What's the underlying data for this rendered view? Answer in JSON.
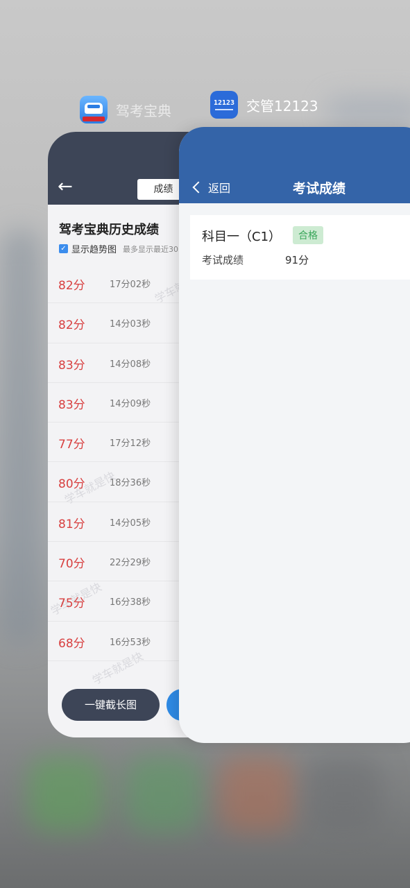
{
  "apps": {
    "jiakao": {
      "name": "驾考宝典",
      "icon": "jiakao-app-icon",
      "header": {
        "tab_label": "成绩",
        "back_icon": "arrow-left-icon"
      },
      "title": "驾考宝典历史成绩",
      "trend_label": "显示趋势图",
      "trend_hint": "最多显示最近30",
      "watermark": "学车就是快",
      "records": [
        {
          "score": "82分",
          "time": "17分02秒"
        },
        {
          "score": "82分",
          "time": "14分03秒"
        },
        {
          "score": "83分",
          "time": "14分08秒"
        },
        {
          "score": "83分",
          "time": "14分09秒"
        },
        {
          "score": "77分",
          "time": "17分12秒"
        },
        {
          "score": "80分",
          "time": "18分36秒"
        },
        {
          "score": "81分",
          "time": "14分05秒"
        },
        {
          "score": "70分",
          "time": "22分29秒"
        },
        {
          "score": "75分",
          "time": "16分38秒"
        },
        {
          "score": "68分",
          "time": "16分53秒"
        }
      ],
      "screenshot_button": "一键截长图",
      "colors": {
        "header": "#3d4557",
        "score": "#d84040"
      }
    },
    "jiaoguan": {
      "name": "交管12123",
      "icon_text": "12123",
      "back_label": "返回",
      "page_title": "考试成绩",
      "result": {
        "subject": "科目一（C1）",
        "status": "合格",
        "score_label": "考试成绩",
        "score_value": "91分"
      },
      "colors": {
        "header": "#3464a8",
        "pass_bg": "#cdebd2",
        "pass_text": "#3aa65a"
      }
    }
  }
}
